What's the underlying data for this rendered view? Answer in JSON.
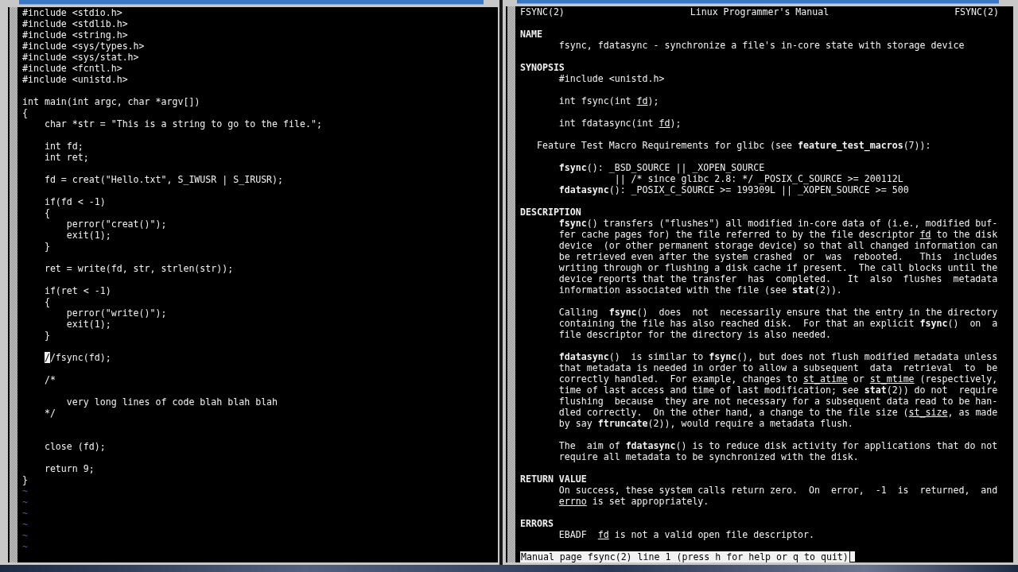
{
  "editor": {
    "blocks": [
      {
        "kind": "normal",
        "lines": [
          {
            "text": "#include <stdio.h>",
            "kind": "top"
          },
          {
            "text": "#include <stdlib.h>",
            "kind": "top"
          },
          {
            "text": "#include <string.h>",
            "kind": "top"
          },
          {
            "text": "#include <sys/types.h>",
            "kind": "top"
          },
          {
            "text": "#include <sys/stat.h>",
            "kind": "top"
          },
          {
            "text": "#include <fcntl.h>",
            "kind": "top"
          },
          {
            "text": "#include <unistd.h>",
            "kind": "top"
          }
        ]
      },
      {
        "kind": "normal",
        "lines": [
          {
            "text": "int main(int argc, char *argv[])",
            "kind": "top"
          },
          {
            "text": "{",
            "kind": "top"
          },
          {
            "text": "char *str = \"This is a string to go to the file.\";",
            "kind": "inner"
          }
        ]
      },
      {
        "kind": "normal",
        "lines": [
          {
            "text": "int fd;",
            "kind": "inner"
          },
          {
            "text": "int ret;",
            "kind": "inner"
          }
        ]
      },
      {
        "kind": "normal",
        "lines": [
          {
            "text": "fd = creat(\"Hello.txt\", S_IWUSR | S_IRUSR);",
            "kind": "inner"
          }
        ]
      },
      {
        "kind": "normal",
        "lines": [
          {
            "text": "if(fd < -1)",
            "kind": "inner"
          },
          {
            "text": "{",
            "kind": "inner"
          },
          {
            "text": "perror(\"creat()\");",
            "kind": "nested"
          },
          {
            "text": "exit(1);",
            "kind": "nested"
          },
          {
            "text": "}",
            "kind": "inner"
          }
        ]
      },
      {
        "kind": "normal",
        "lines": [
          {
            "text": "ret = write(fd, str, strlen(str));",
            "kind": "inner"
          }
        ]
      },
      {
        "kind": "normal",
        "lines": [
          {
            "text": "if(ret < -1)",
            "kind": "inner"
          },
          {
            "text": "{",
            "kind": "inner"
          },
          {
            "text": "perror(\"write()\");",
            "kind": "nested"
          },
          {
            "text": "exit(1);",
            "kind": "nested"
          },
          {
            "text": "}",
            "kind": "inner"
          }
        ]
      },
      {
        "kind": "normal",
        "lines": [
          {
            "text": "//fsync(fd);",
            "kind": "inner",
            "cursor": true
          }
        ]
      },
      {
        "kind": "normal",
        "lines": [
          {
            "text": "/*",
            "kind": "inner"
          }
        ]
      },
      {
        "kind": "normal",
        "lines": [
          {
            "text": "very long lines of code blah blah blah",
            "kind": "nested"
          },
          {
            "text": "*/",
            "kind": "inner"
          }
        ]
      },
      {
        "kind": "wide",
        "lines": [
          {
            "text": "close (fd);",
            "kind": "inner"
          }
        ]
      },
      {
        "kind": "normal",
        "lines": [
          {
            "text": "return 9;",
            "kind": "inner"
          },
          {
            "text": "}",
            "kind": "top"
          }
        ]
      }
    ],
    "filler_lines": [
      "~",
      "~",
      "~",
      "~",
      "~",
      "~"
    ]
  },
  "man_page": {
    "header": {
      "left": "FSYNC(2)",
      "center": "Linux Programmer's Manual",
      "right": "FSYNC(2)"
    },
    "sections": [
      {
        "heading": "NAME",
        "paragraphs": [
          {
            "lines": [
              {
                "text": "fsync, fdatasync - synchronize a file's in-core state with storage device",
                "kind": "body"
              }
            ]
          }
        ]
      },
      {
        "heading": "SYNOPSIS",
        "paragraphs": [
          {
            "lines": [
              {
                "text": "#include <unistd.h>",
                "kind": "body"
              }
            ]
          },
          {
            "lines": [
              {
                "text": "int fsync(int *fd*);",
                "kind": "body"
              }
            ]
          },
          {
            "lines": [
              {
                "text": "int fdatasync(int *fd*);",
                "kind": "body"
              }
            ]
          },
          {
            "lines": [
              {
                "text": "Feature Test Macro Requirements for glibc (see **feature_test_macros**(7)):",
                "kind": "note"
              }
            ]
          },
          {
            "lines": [
              {
                "text": "**fsync**(): _BSD_SOURCE || _XOPEN_SOURCE",
                "kind": "body"
              },
              {
                "text": "|| /* since glibc 2.8: */ _POSIX_C_SOURCE >= 200112L",
                "kind": "code"
              },
              {
                "text": "**fdatasync**(): _POSIX_C_SOURCE >= 199309L || _XOPEN_SOURCE >= 500",
                "kind": "body"
              }
            ]
          }
        ]
      },
      {
        "heading": "DESCRIPTION",
        "paragraphs": [
          {
            "lines": [
              {
                "text": "**fsync**() transfers (\"flushes\") all modified in-core data of (i.e., modified buf-",
                "kind": "body"
              },
              {
                "text": "fer cache pages for) the file referred to by the file descriptor *fd* to the disk",
                "kind": "body"
              },
              {
                "text": "device  (or other permanent storage device) so that all changed information can",
                "kind": "body"
              },
              {
                "text": "be retrieved even after the system crashed  or  was  rebooted.   This  includes",
                "kind": "body"
              },
              {
                "text": "writing through or flushing a disk cache if present.  The call blocks until the",
                "kind": "body"
              },
              {
                "text": "device reports that the transfer  has  completed.   It  also  flushes  metadata",
                "kind": "body"
              },
              {
                "text": "information associated with the file (see **stat**(2)).",
                "kind": "body"
              }
            ]
          },
          {
            "lines": [
              {
                "text": "Calling  **fsync**()  does  not  necessarily ensure that the entry in the directory",
                "kind": "body"
              },
              {
                "text": "containing the file has also reached disk.  For that an explicit **fsync**()  on  a",
                "kind": "body"
              },
              {
                "text": "file descriptor for the directory is also needed.",
                "kind": "body"
              }
            ]
          },
          {
            "lines": [
              {
                "text": "**fdatasync**()  is similar to **fsync**(), but does not flush modified metadata unless",
                "kind": "body"
              },
              {
                "text": "that metadata is needed in order to allow a subsequent  data  retrieval  to  be",
                "kind": "body"
              },
              {
                "text": "correctly handled.  For example, changes to *st_atime* or *st_mtime* (respectively,",
                "kind": "body"
              },
              {
                "text": "time of last access and time of last modification; see **stat**(2)) do not  require",
                "kind": "body"
              },
              {
                "text": "flushing  because  they are not necessary for a subsequent data read to be han-",
                "kind": "body"
              },
              {
                "text": "dled correctly.  On the other hand, a change to the file size (*st_size*, as made",
                "kind": "body"
              },
              {
                "text": "by say **ftruncate**(2)), would require a metadata flush.",
                "kind": "body"
              }
            ]
          },
          {
            "lines": [
              {
                "text": "The  aim of **fdatasync**() is to reduce disk activity for applications that do not",
                "kind": "body"
              },
              {
                "text": "require all metadata to be synchronized with the disk.",
                "kind": "body"
              }
            ]
          }
        ]
      },
      {
        "heading": "RETURN VALUE",
        "paragraphs": [
          {
            "lines": [
              {
                "text": "On success, these system calls return zero.  On  error,  -1  is  returned,  and",
                "kind": "body"
              },
              {
                "text": "*errno* is set appropriately.",
                "kind": "body"
              }
            ]
          }
        ]
      },
      {
        "heading": "ERRORS",
        "paragraphs": [
          {
            "lines": [
              {
                "text": "EBADF  *fd* is not a valid open file descriptor.",
                "kind": "body"
              }
            ]
          }
        ]
      }
    ],
    "status_line": "Manual page fsync(2) line 1 (press h for help or q to quit)"
  }
}
